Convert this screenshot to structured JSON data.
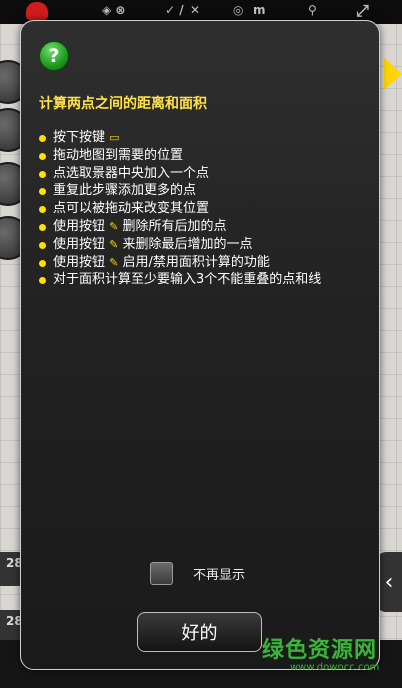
{
  "status_bar": {
    "check_slash": "✓ /",
    "m_label": "m"
  },
  "background": {
    "left_nums": [
      "28",
      "28"
    ]
  },
  "dialog": {
    "icon": "question-mark-icon",
    "icon_text": "?",
    "title": "计算两点之间的距离和面积",
    "items": [
      {
        "text": "按下按键",
        "icon": "ruler-icon"
      },
      {
        "text": "拖动地图到需要的位置"
      },
      {
        "text": "点选取景器中央加入一个点"
      },
      {
        "text": "重复此步骤添加更多的点"
      },
      {
        "text": "点可以被拖动来改变其位置"
      },
      {
        "pre": "使用按钮",
        "icon": "clear-all-icon",
        "post": "删除所有后加的点"
      },
      {
        "pre": "使用按钮",
        "icon": "undo-last-icon",
        "post": "来删除最后增加的一点"
      },
      {
        "pre": "使用按钮",
        "icon": "area-toggle-icon",
        "post": "启用/禁用面积计算的功能"
      },
      {
        "text": "对于面积计算至少要输入3个不能重叠的点和线"
      }
    ],
    "checkbox_label": "不再显示",
    "checkbox_checked": false,
    "ok_label": "好的"
  },
  "watermark": {
    "logo_text": "绿色资源网",
    "url": "www.downcc.com"
  },
  "colors": {
    "title": "#ffe24a",
    "bullet": "#ffe000",
    "dialog_bg": "#232323",
    "watermark": "#39b539"
  }
}
